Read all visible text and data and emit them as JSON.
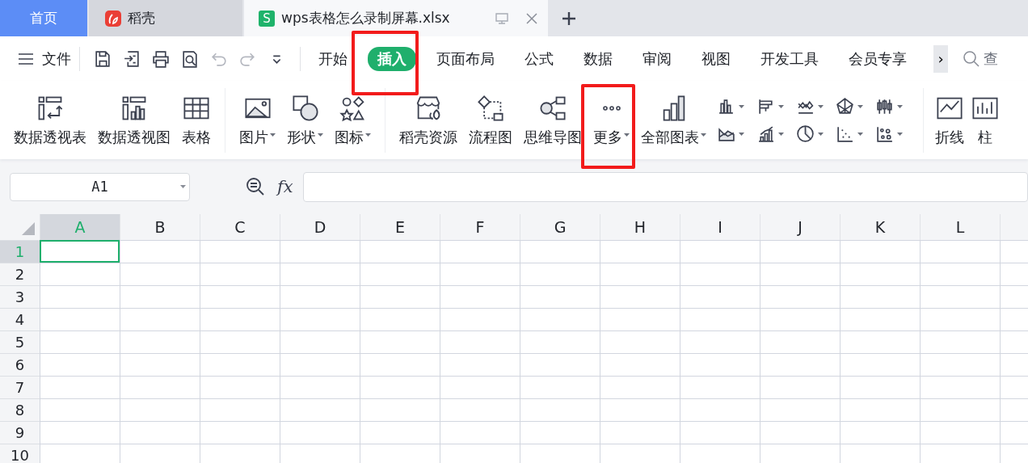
{
  "tabs": [
    {
      "kind": "home",
      "label": "首页",
      "selected": false
    },
    {
      "kind": "app",
      "label": "稻壳",
      "selected": false
    },
    {
      "kind": "file",
      "label": "wps表格怎么录制屏幕.xlsx",
      "badge": "S",
      "selected": true
    }
  ],
  "menu": {
    "file_label": "文件",
    "ribbon_tabs": [
      {
        "label": "开始",
        "selected": false,
        "highlighted": false
      },
      {
        "label": "插入",
        "selected": true,
        "highlighted": true
      },
      {
        "label": "页面布局",
        "selected": false,
        "highlighted": false
      },
      {
        "label": "公式",
        "selected": false,
        "highlighted": false
      },
      {
        "label": "数据",
        "selected": false,
        "highlighted": false
      },
      {
        "label": "审阅",
        "selected": false,
        "highlighted": false
      },
      {
        "label": "视图",
        "selected": false,
        "highlighted": false
      },
      {
        "label": "开发工具",
        "selected": false,
        "highlighted": false
      },
      {
        "label": "会员专享",
        "selected": false,
        "highlighted": false
      }
    ],
    "more": "›",
    "search": "查"
  },
  "ribbon": {
    "groups": [
      {
        "items": [
          {
            "label": "数据透视表",
            "dropdown": false,
            "highlighted": false
          },
          {
            "label": "数据透视图",
            "dropdown": false,
            "highlighted": false
          },
          {
            "label": "表格",
            "dropdown": false,
            "highlighted": false
          }
        ]
      },
      {
        "items": [
          {
            "label": "图片",
            "dropdown": true,
            "highlighted": false
          },
          {
            "label": "形状",
            "dropdown": true,
            "highlighted": false
          },
          {
            "label": "图标",
            "dropdown": true,
            "highlighted": false
          }
        ]
      },
      {
        "items": [
          {
            "label": "稻壳资源",
            "dropdown": false,
            "highlighted": false
          },
          {
            "label": "流程图",
            "dropdown": false,
            "highlighted": false
          },
          {
            "label": "思维导图",
            "dropdown": false,
            "highlighted": false
          },
          {
            "label": "更多",
            "dropdown": true,
            "highlighted": true
          }
        ]
      },
      {
        "items": [
          {
            "label": "全部图表",
            "dropdown": true,
            "highlighted": false
          }
        ]
      }
    ],
    "end_items": [
      {
        "label": "折线"
      },
      {
        "label": "柱"
      }
    ]
  },
  "name_box": {
    "value": "A1"
  },
  "formula_bar": {
    "fx": "fx"
  },
  "sheet": {
    "columns": [
      {
        "label": "A",
        "selected": true
      },
      {
        "label": "B",
        "selected": false
      },
      {
        "label": "C",
        "selected": false
      },
      {
        "label": "D",
        "selected": false
      },
      {
        "label": "E",
        "selected": false
      },
      {
        "label": "F",
        "selected": false
      },
      {
        "label": "G",
        "selected": false
      },
      {
        "label": "H",
        "selected": false
      },
      {
        "label": "I",
        "selected": false
      },
      {
        "label": "J",
        "selected": false
      },
      {
        "label": "K",
        "selected": false
      },
      {
        "label": "L",
        "selected": false
      }
    ],
    "rows": [
      {
        "label": "1",
        "selected": true
      },
      {
        "label": "2",
        "selected": false
      },
      {
        "label": "3",
        "selected": false
      },
      {
        "label": "4",
        "selected": false
      },
      {
        "label": "5",
        "selected": false
      },
      {
        "label": "6",
        "selected": false
      },
      {
        "label": "7",
        "selected": false
      },
      {
        "label": "8",
        "selected": false
      },
      {
        "label": "9",
        "selected": false
      },
      {
        "label": "10",
        "selected": false
      }
    ]
  }
}
